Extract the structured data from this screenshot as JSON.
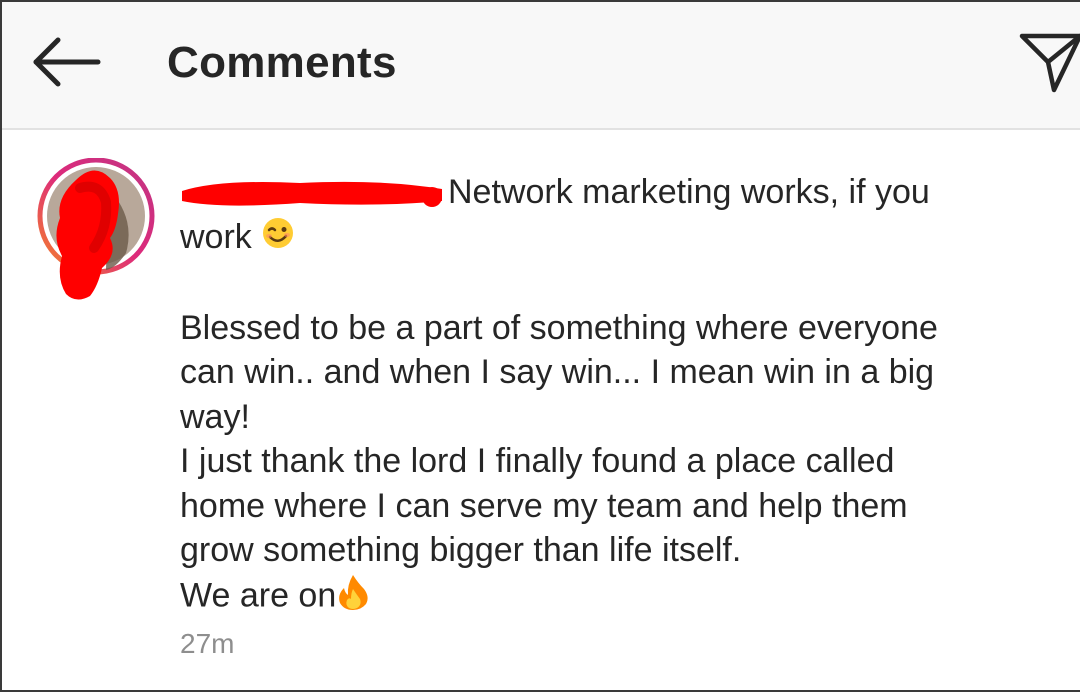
{
  "header": {
    "title": "Comments",
    "back_icon": "arrow-left-icon",
    "send_icon": "paper-plane-icon"
  },
  "comment": {
    "username_redacted": true,
    "first_line_text": "Network marketing works, if you",
    "second_line_text": "work",
    "wink_emoji": "wink-emoji",
    "body_lines": [
      "Blessed to be a part of something where everyone",
      "can win.. and when I say win... I mean win in a big",
      "way!",
      "I just thank the lord I finally found a place called",
      "home where I can serve my team and help them",
      "grow something bigger than life itself."
    ],
    "last_line_text": "We are on",
    "fire_emoji": "fire-emoji",
    "timestamp": "27m"
  },
  "colors": {
    "text": "#262626",
    "muted": "#8e8e8e",
    "header_bg": "#f8f8f8",
    "redaction": "#ff0000",
    "story_ring_start": "#f58529",
    "story_ring_end": "#c13584"
  }
}
